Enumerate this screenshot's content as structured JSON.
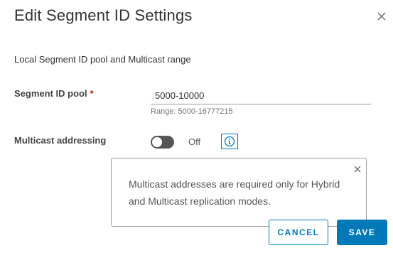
{
  "dialog": {
    "title": "Edit Segment ID Settings",
    "close_icon": "close-icon"
  },
  "section": {
    "label": "Local Segment ID pool and Multicast range"
  },
  "segment_id_pool": {
    "label": "Segment ID pool",
    "required_marker": "*",
    "value": "5000-10000",
    "helper": "Range: 5000-16777215"
  },
  "multicast": {
    "label": "Multicast addressing",
    "toggle_state": "Off",
    "info_icon": "info-icon"
  },
  "popover": {
    "text": "Multicast addresses are required only for Hybrid and Multicast replication modes.",
    "close_icon": "close-icon"
  },
  "footer": {
    "cancel_label": "CANCEL",
    "save_label": "SAVE"
  },
  "colors": {
    "primary": "#0079b8",
    "required": "#c92100",
    "toggle_off": "#565656"
  }
}
